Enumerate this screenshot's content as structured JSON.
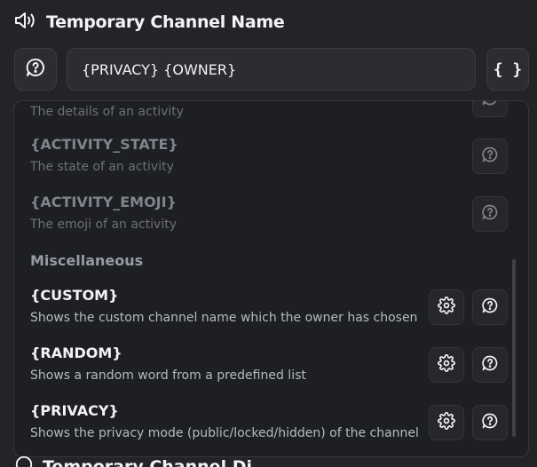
{
  "header": {
    "title": "Temporary Channel Name",
    "icon": "speaker-icon"
  },
  "name_field": {
    "value": "{PRIVACY} {OWNER}",
    "left_button_icon": "help-bubble-icon",
    "right_button_label": "{ }"
  },
  "dropdown": {
    "partial_item_desc": "The details of an activity",
    "items_activity": [
      {
        "token": "{ACTIVITY_STATE}",
        "desc": "The state of an activity"
      },
      {
        "token": "{ACTIVITY_EMOJI}",
        "desc": "The emoji of an activity"
      }
    ],
    "section_label": "Miscellaneous",
    "items_misc": [
      {
        "token": "{CUSTOM}",
        "desc": "Shows the custom channel name which the owner has chosen"
      },
      {
        "token": "{RANDOM}",
        "desc": "Shows a random word from a predefined list"
      },
      {
        "token": "{PRIVACY}",
        "desc": "Shows the privacy mode (public/locked/hidden) of the channel"
      }
    ]
  },
  "next_section": {
    "title": "Temporary Channel Di..."
  },
  "colors": {
    "background": "#232428",
    "dropdown_bg": "#1e1f22",
    "text": "#f2f3f5",
    "muted": "#80848e"
  }
}
